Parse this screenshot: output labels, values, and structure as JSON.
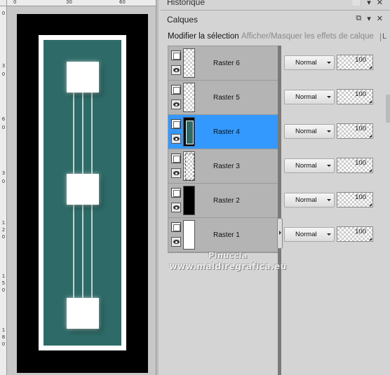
{
  "rulers": {
    "top_labels": [
      "0",
      "30",
      "60"
    ],
    "left_labels": [
      [
        "0"
      ],
      [
        "3",
        "0"
      ],
      [
        "6",
        "0"
      ],
      [
        "3",
        "0"
      ],
      [
        "1",
        "2",
        "0"
      ],
      [
        "1",
        "5",
        "0"
      ],
      [
        "1",
        "8",
        "0"
      ]
    ]
  },
  "history_panel": {
    "title": "Historique"
  },
  "layers_panel": {
    "title": "Calques",
    "toolbar": {
      "edit_selection": "Modifier la sélection",
      "show_hide_effects": "Afficher/Masquer les effets de calque",
      "more": "L"
    },
    "layers": [
      {
        "name": "Raster 6",
        "thumbnail": "transparent",
        "selected": false,
        "blend_mode": "Normal",
        "opacity": "100"
      },
      {
        "name": "Raster 5",
        "thumbnail": "transparent",
        "selected": false,
        "blend_mode": "Normal",
        "opacity": "100"
      },
      {
        "name": "Raster 4",
        "thumbnail": "teal-frame",
        "selected": true,
        "blend_mode": "Normal",
        "opacity": "100"
      },
      {
        "name": "Raster 3",
        "thumbnail": "white-border",
        "selected": false,
        "blend_mode": "Normal",
        "opacity": "100"
      },
      {
        "name": "Raster 2",
        "thumbnail": "black",
        "selected": false,
        "blend_mode": "Normal",
        "opacity": "100"
      },
      {
        "name": "Raster 1",
        "thumbnail": "white",
        "selected": false,
        "blend_mode": "Normal",
        "opacity": "100"
      }
    ]
  },
  "watermark": {
    "line1": "Pinuccia",
    "line2": "www.maldiregrafica.eu"
  },
  "colors": {
    "selection_blue": "#3399ff",
    "teal": "#2e6b68",
    "panel_bg": "#d4d4d4"
  },
  "icons": {
    "history_pin": "pin-icon",
    "history_menu": "menu-arrow-icon",
    "history_close": "close-icon",
    "layer_group": "layer-group-icon",
    "layer_visibility": "eye-icon"
  }
}
